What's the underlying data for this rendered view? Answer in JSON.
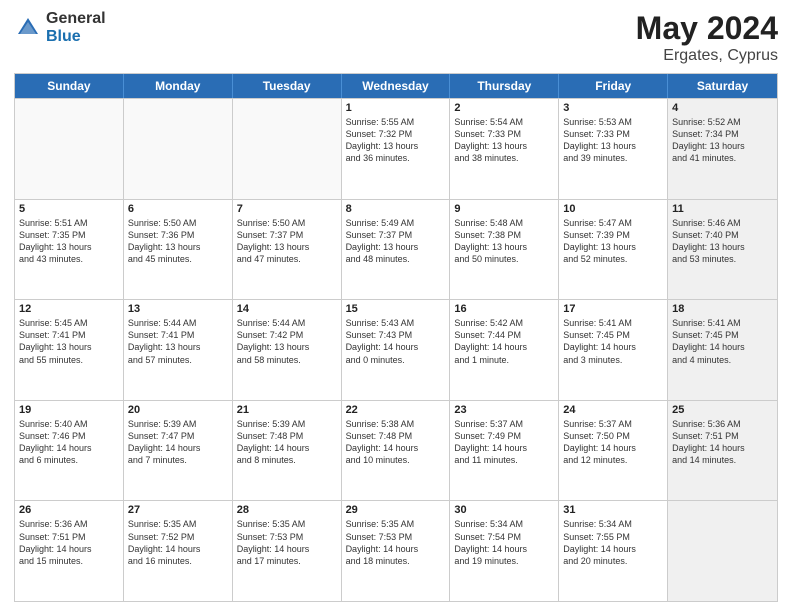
{
  "logo": {
    "general": "General",
    "blue": "Blue"
  },
  "title": {
    "month": "May 2024",
    "location": "Ergates, Cyprus"
  },
  "header_days": [
    "Sunday",
    "Monday",
    "Tuesday",
    "Wednesday",
    "Thursday",
    "Friday",
    "Saturday"
  ],
  "rows": [
    [
      {
        "day": "",
        "info": "",
        "empty": true
      },
      {
        "day": "",
        "info": "",
        "empty": true
      },
      {
        "day": "",
        "info": "",
        "empty": true
      },
      {
        "day": "1",
        "info": "Sunrise: 5:55 AM\nSunset: 7:32 PM\nDaylight: 13 hours\nand 36 minutes."
      },
      {
        "day": "2",
        "info": "Sunrise: 5:54 AM\nSunset: 7:33 PM\nDaylight: 13 hours\nand 38 minutes."
      },
      {
        "day": "3",
        "info": "Sunrise: 5:53 AM\nSunset: 7:33 PM\nDaylight: 13 hours\nand 39 minutes."
      },
      {
        "day": "4",
        "info": "Sunrise: 5:52 AM\nSunset: 7:34 PM\nDaylight: 13 hours\nand 41 minutes.",
        "shaded": true
      }
    ],
    [
      {
        "day": "5",
        "info": "Sunrise: 5:51 AM\nSunset: 7:35 PM\nDaylight: 13 hours\nand 43 minutes."
      },
      {
        "day": "6",
        "info": "Sunrise: 5:50 AM\nSunset: 7:36 PM\nDaylight: 13 hours\nand 45 minutes."
      },
      {
        "day": "7",
        "info": "Sunrise: 5:50 AM\nSunset: 7:37 PM\nDaylight: 13 hours\nand 47 minutes."
      },
      {
        "day": "8",
        "info": "Sunrise: 5:49 AM\nSunset: 7:37 PM\nDaylight: 13 hours\nand 48 minutes."
      },
      {
        "day": "9",
        "info": "Sunrise: 5:48 AM\nSunset: 7:38 PM\nDaylight: 13 hours\nand 50 minutes."
      },
      {
        "day": "10",
        "info": "Sunrise: 5:47 AM\nSunset: 7:39 PM\nDaylight: 13 hours\nand 52 minutes."
      },
      {
        "day": "11",
        "info": "Sunrise: 5:46 AM\nSunset: 7:40 PM\nDaylight: 13 hours\nand 53 minutes.",
        "shaded": true
      }
    ],
    [
      {
        "day": "12",
        "info": "Sunrise: 5:45 AM\nSunset: 7:41 PM\nDaylight: 13 hours\nand 55 minutes."
      },
      {
        "day": "13",
        "info": "Sunrise: 5:44 AM\nSunset: 7:41 PM\nDaylight: 13 hours\nand 57 minutes."
      },
      {
        "day": "14",
        "info": "Sunrise: 5:44 AM\nSunset: 7:42 PM\nDaylight: 13 hours\nand 58 minutes."
      },
      {
        "day": "15",
        "info": "Sunrise: 5:43 AM\nSunset: 7:43 PM\nDaylight: 14 hours\nand 0 minutes."
      },
      {
        "day": "16",
        "info": "Sunrise: 5:42 AM\nSunset: 7:44 PM\nDaylight: 14 hours\nand 1 minute."
      },
      {
        "day": "17",
        "info": "Sunrise: 5:41 AM\nSunset: 7:45 PM\nDaylight: 14 hours\nand 3 minutes."
      },
      {
        "day": "18",
        "info": "Sunrise: 5:41 AM\nSunset: 7:45 PM\nDaylight: 14 hours\nand 4 minutes.",
        "shaded": true
      }
    ],
    [
      {
        "day": "19",
        "info": "Sunrise: 5:40 AM\nSunset: 7:46 PM\nDaylight: 14 hours\nand 6 minutes."
      },
      {
        "day": "20",
        "info": "Sunrise: 5:39 AM\nSunset: 7:47 PM\nDaylight: 14 hours\nand 7 minutes."
      },
      {
        "day": "21",
        "info": "Sunrise: 5:39 AM\nSunset: 7:48 PM\nDaylight: 14 hours\nand 8 minutes."
      },
      {
        "day": "22",
        "info": "Sunrise: 5:38 AM\nSunset: 7:48 PM\nDaylight: 14 hours\nand 10 minutes."
      },
      {
        "day": "23",
        "info": "Sunrise: 5:37 AM\nSunset: 7:49 PM\nDaylight: 14 hours\nand 11 minutes."
      },
      {
        "day": "24",
        "info": "Sunrise: 5:37 AM\nSunset: 7:50 PM\nDaylight: 14 hours\nand 12 minutes."
      },
      {
        "day": "25",
        "info": "Sunrise: 5:36 AM\nSunset: 7:51 PM\nDaylight: 14 hours\nand 14 minutes.",
        "shaded": true
      }
    ],
    [
      {
        "day": "26",
        "info": "Sunrise: 5:36 AM\nSunset: 7:51 PM\nDaylight: 14 hours\nand 15 minutes."
      },
      {
        "day": "27",
        "info": "Sunrise: 5:35 AM\nSunset: 7:52 PM\nDaylight: 14 hours\nand 16 minutes."
      },
      {
        "day": "28",
        "info": "Sunrise: 5:35 AM\nSunset: 7:53 PM\nDaylight: 14 hours\nand 17 minutes."
      },
      {
        "day": "29",
        "info": "Sunrise: 5:35 AM\nSunset: 7:53 PM\nDaylight: 14 hours\nand 18 minutes."
      },
      {
        "day": "30",
        "info": "Sunrise: 5:34 AM\nSunset: 7:54 PM\nDaylight: 14 hours\nand 19 minutes."
      },
      {
        "day": "31",
        "info": "Sunrise: 5:34 AM\nSunset: 7:55 PM\nDaylight: 14 hours\nand 20 minutes."
      },
      {
        "day": "",
        "info": "",
        "empty": true,
        "shaded": true
      }
    ]
  ]
}
